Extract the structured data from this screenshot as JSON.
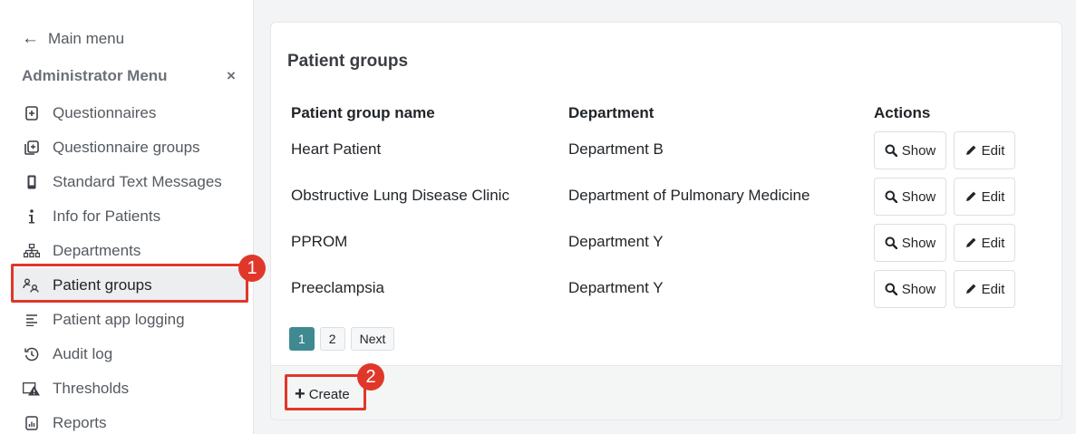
{
  "sidebar": {
    "back_label": "Main menu",
    "menu_title": "Administrator Menu",
    "close_glyph": "×",
    "items": [
      {
        "label": "Questionnaires",
        "icon": "file-plus-icon"
      },
      {
        "label": "Questionnaire groups",
        "icon": "files-icon"
      },
      {
        "label": "Standard Text Messages",
        "icon": "phone-icon"
      },
      {
        "label": "Info for Patients",
        "icon": "info-icon"
      },
      {
        "label": "Departments",
        "icon": "hierarchy-icon"
      },
      {
        "label": "Patient groups",
        "icon": "people-icon",
        "active": true
      },
      {
        "label": "Patient app logging",
        "icon": "lines-icon"
      },
      {
        "label": "Audit log",
        "icon": "history-icon"
      },
      {
        "label": "Thresholds",
        "icon": "warning-image-icon"
      },
      {
        "label": "Reports",
        "icon": "report-icon"
      }
    ]
  },
  "main": {
    "title": "Patient groups",
    "columns": [
      "Patient group name",
      "Department",
      "Actions"
    ],
    "rows": [
      {
        "name": "Heart Patient",
        "department": "Department B"
      },
      {
        "name": "Obstructive Lung Disease Clinic",
        "department": "Department of Pulmonary Medicine"
      },
      {
        "name": "PPROM",
        "department": "Department Y"
      },
      {
        "name": "Preeclampsia",
        "department": "Department Y"
      }
    ],
    "show_label": "Show",
    "edit_label": "Edit",
    "pagination": {
      "pages": [
        "1",
        "2"
      ],
      "current": "1",
      "next_label": "Next"
    },
    "create_label": "Create"
  },
  "annotations": {
    "badge_1": "1",
    "badge_2": "2",
    "color": "#e0372b"
  },
  "colors": {
    "accent": "#3f8a91"
  }
}
